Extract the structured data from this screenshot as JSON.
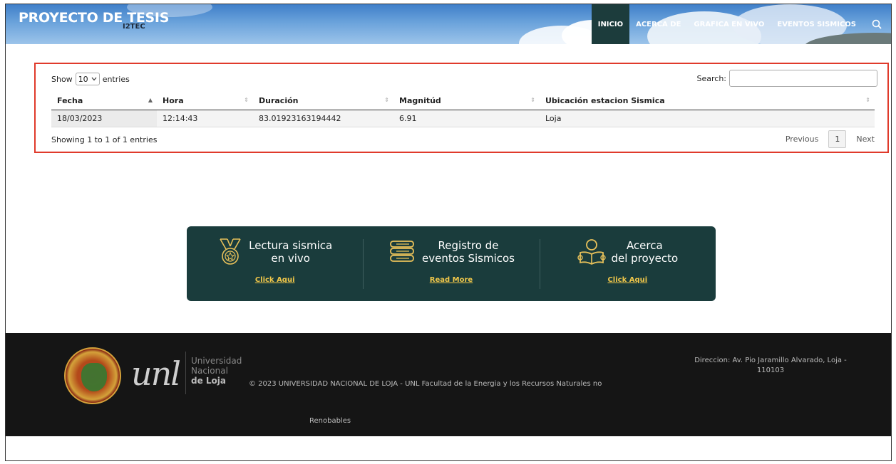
{
  "header": {
    "brand_title": "PROYECTO DE TESIS",
    "brand_sub": "I2TEC",
    "nav": [
      "INICIO",
      "ACERCA DE",
      "GRAFICA EN VIVO",
      "EVENTOS SISMICOS"
    ],
    "active_nav": "INICIO",
    "search_icon": "search-icon"
  },
  "table_controls": {
    "show_label": "Show",
    "entries_value": "10",
    "entries_label": "entries",
    "search_label": "Search:",
    "search_value": ""
  },
  "table": {
    "columns": [
      "Fecha",
      "Hora",
      "Duración",
      "Magnitúd",
      "Ubicación estacion Sismica"
    ],
    "rows": [
      [
        "18/03/2023",
        "12:14:43",
        "83.01923163194442",
        "6.91",
        "Loja"
      ]
    ],
    "info": "Showing 1 to 1 of 1 entries",
    "pagination": {
      "previous": "Previous",
      "page": "1",
      "next": "Next"
    }
  },
  "features": [
    {
      "icon": "medal-icon",
      "title_l1": "Lectura sismica",
      "title_l2": "en vivo",
      "link": "Click Aqui"
    },
    {
      "icon": "books-icon",
      "title_l1": "Registro de",
      "title_l2": "eventos Sismicos",
      "link": "Read More"
    },
    {
      "icon": "reader-icon",
      "title_l1": "Acerca",
      "title_l2": "del proyecto",
      "link": "Click Aqui"
    }
  ],
  "footer": {
    "univ_l1": "Universidad",
    "univ_l2": "Nacional",
    "univ_l3": "de Loja",
    "unl_logo": "unl",
    "copyright": "© 2023 UNIVERSIDAD NACIONAL DE LOJA - UNL Facultad de la Energia y los Recursos Naturales no",
    "copyright_2": "Renobables",
    "address": "Direccion: Av. Pio Jaramillo Alvarado, Loja - 110103"
  },
  "colors": {
    "nav_active": "#1c3c3c",
    "banner_bg": "#1a3c3c",
    "link_gold": "#f0c74a",
    "highlight_border": "#e03a2b",
    "footer_bg": "#151515"
  }
}
